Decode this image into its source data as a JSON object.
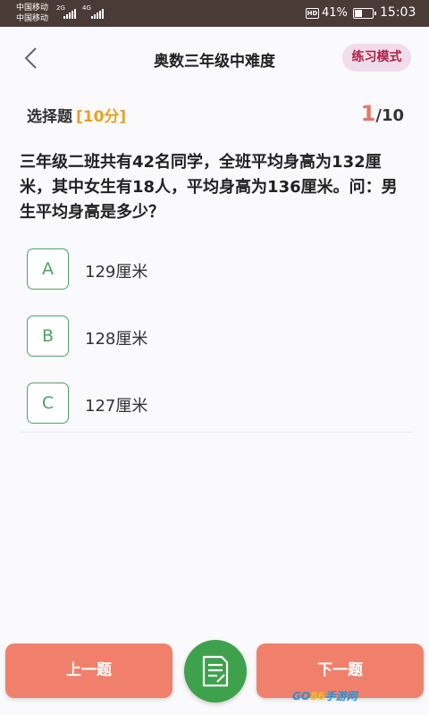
{
  "status_bar": {
    "carrier_1": "中国移动",
    "carrier_2": "中国移动",
    "network_1": "2G",
    "network_2": "4G",
    "hd": "HD",
    "battery_percent": "41%",
    "battery_level": 0.41,
    "time": "15:03"
  },
  "header": {
    "title": "奥数三年级中难度",
    "mode_badge": "练习模式"
  },
  "question_meta": {
    "type": "选择题",
    "score": "[10分]",
    "current": "1",
    "separator": "/",
    "total": "10"
  },
  "question": {
    "text": "三年级二班共有42名同学，全班平均身高为132厘米，其中女生有18人，平均身高为136厘米。问：男生平均身高是多少？"
  },
  "options": [
    {
      "letter": "A",
      "text": "129厘米"
    },
    {
      "letter": "B",
      "text": "128厘米"
    },
    {
      "letter": "C",
      "text": "127厘米"
    }
  ],
  "footer": {
    "prev_label": "上一题",
    "next_label": "下一题",
    "answer_sheet_icon": "answer-sheet-icon",
    "watermark_a": "GO",
    "watermark_b": "86",
    "watermark_c": "手游网"
  },
  "colors": {
    "accent_green": "#4da36a",
    "button_coral": "#f0806c",
    "score_gold": "#e8a21d",
    "mode_badge_text": "#b0204a"
  }
}
